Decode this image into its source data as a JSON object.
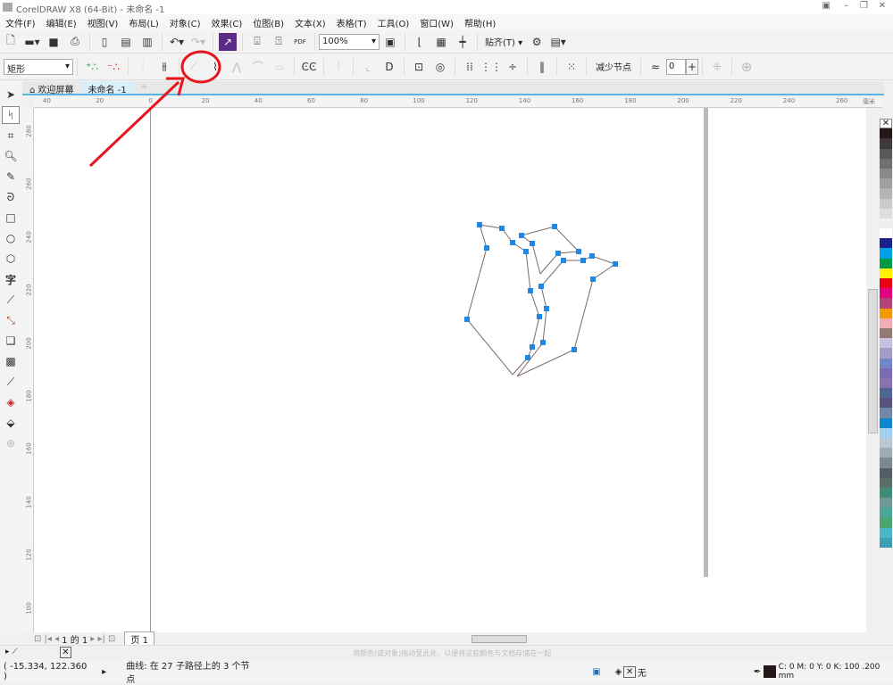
{
  "title": "CorelDRAW X8 (64-Bit) - 未命名 -1",
  "menu": [
    "文件(F)",
    "编辑(E)",
    "视图(V)",
    "布局(L)",
    "对象(C)",
    "效果(C)",
    "位图(B)",
    "文本(X)",
    "表格(T)",
    "工具(O)",
    "窗口(W)",
    "帮助(H)"
  ],
  "toolbar": {
    "zoom": "100%",
    "snap": "贴齐(T)"
  },
  "property_bar": {
    "shape": "矩形",
    "reduce_nodes": "减少节点",
    "smoothness": "0"
  },
  "tabs": [
    "欢迎屏幕",
    "未命名 -1"
  ],
  "ruler": {
    "unit": "毫米",
    "h_labels": [
      "40",
      "20",
      "0",
      "20",
      "40",
      "60",
      "80",
      "100",
      "120",
      "140",
      "160",
      "180",
      "200",
      "220",
      "240",
      "260"
    ],
    "v_labels": [
      "280",
      "260",
      "240",
      "220",
      "200",
      "180",
      "160",
      "140",
      "120",
      "100"
    ]
  },
  "page_nav": {
    "current": "1 的 1",
    "page_tab": "页 1"
  },
  "colorbar_hint": "将颜色(或对象)拖动至此处，以便将这些颜色与文档存储在一起",
  "status": {
    "coords": "( -15.334, 122.360 )",
    "info": "曲线: 在 27 子路径上的 3 个节点",
    "fill": "无",
    "outline": "C: 0 M: 0 Y: 0 K: 100  .200 mm"
  },
  "colors": {
    "accent": "#1e88e5",
    "annotation": "#e8141c"
  },
  "palette": [
    "#231815",
    "#3e3a39",
    "#595757",
    "#717071",
    "#898989",
    "#9fa0a0",
    "#b5b5b6",
    "#c9caca",
    "#dcdddd",
    "#efefef",
    "#ffffff",
    "#1d2088",
    "#00a0e9",
    "#009944",
    "#fff100",
    "#e60012",
    "#e4007f",
    "#b3417a",
    "#f39800",
    "#f2aeb4",
    "#8f7b6f",
    "#c9c1e0",
    "#a59aca",
    "#6f87c6",
    "#7c6bb0",
    "#8a73ac",
    "#4e6692",
    "#5a5079",
    "#7189a6",
    "#0e86d0",
    "#9fd0ef",
    "#b8c9d5",
    "#9eacb6",
    "#7b8993",
    "#555f66",
    "#5a6e6b",
    "#3f8c78",
    "#6e9a94",
    "#4ba598",
    "#4da56f",
    "#47b7c8",
    "#3d9fb6"
  ]
}
